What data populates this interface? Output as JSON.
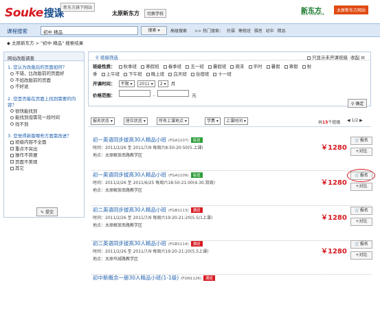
{
  "header": {
    "logo_main": "Souke",
    "logo_ke": "搜课",
    "sub_tag": "新东方旗下网站",
    "city": "太原新东方",
    "switch_school": "切换学校",
    "brand": "新东方",
    "brand_sub": "NEW ORIENTAL",
    "top_button": "太原新东方网站"
  },
  "search": {
    "label": "课程搜索",
    "query": "初中 精品",
    "search_button": "搜索",
    "advanced": "高级搜索",
    "hot_label": ">> 热门搜索：",
    "hot_items": [
      "托福",
      "寒假班",
      "雅思",
      "初中",
      "精品"
    ]
  },
  "breadcrumb": "太原新东方 > \"初中 精品\" 搜索结果",
  "survey": {
    "title": "网站改版调查",
    "q1": "1. 您认为改版后的页面如何？",
    "q1_opts": [
      "不错，比改版前的页面好",
      "不如改版前的页面",
      "不好说"
    ],
    "q2": "2. 您是否能在页面上找到需要的内容？",
    "q2_opts": [
      "很快能找到",
      "能找到但需花一段时间",
      "找不到"
    ],
    "q3": "3. 您觉得新版哪些方面需改进？",
    "q3_opts": [
      "班级内容不全面",
      "重点不突出",
      "操作不简便",
      "页面不美观",
      "其它"
    ],
    "submit": "提交"
  },
  "filter": {
    "title": "班级筛选",
    "only_open": "只显示未开课班级",
    "collapse": "收起",
    "type_label": "班级性质：",
    "types_row1": [
      "秋季班",
      "寒假班",
      "春季班",
      "五一班",
      "暑假班",
      "周末",
      "平时",
      "暑假",
      "寒假",
      "秋"
    ],
    "types_row2": [
      "季",
      "上午班",
      "下午班",
      "晚上班",
      "白天班",
      "住宿班",
      "十一班"
    ],
    "time_label": "开课时间：",
    "time_limit": "不限",
    "time_year": "2011",
    "time_month": "2",
    "time_unit": "月",
    "price_label": "价格范围：",
    "price_sep": "-",
    "price_unit": "元",
    "confirm": "确定"
  },
  "sortbar": {
    "status": "报名状态",
    "seats": "座位状态",
    "location": "所有上课地点",
    "tuition": "学费",
    "start": "上课时间",
    "total_pre": "共",
    "total_num": "15",
    "total_post": "个班级",
    "pager": "1/2"
  },
  "courses": [
    {
      "title": "初一英语同步拔高30人精品小班",
      "code": "(FGA1107)",
      "tag": "有班",
      "tag_color": "#2e9e3a",
      "time": "时间：2011/2/26 至 2011/7/9  每周六8:50-20:50(5.上课)",
      "place": "地点：太原解放南路教学区",
      "price": "￥1280",
      "signup": "报名",
      "compare": "对比"
    },
    {
      "title": "初一英语同步拔高30人精品小班",
      "code": "(FGA1109)",
      "tag": "有班",
      "tag_color": "#2e9e3a",
      "time": "时间：2011/2/26 至 2011/6/25  每周六18:50-21:00(4.30.双周)",
      "place": "地点：太原解放南路教学区",
      "price": "￥1280",
      "signup": "报名",
      "compare": "对比"
    },
    {
      "title": "初二英语同步拔高30人精品小班",
      "code": "(FGB1113)",
      "tag": "满班",
      "tag_color": "#d71920",
      "time": "时间：2011/2/26 至 2011/7/9  每周六19:20-21:20(5.5/1上课)",
      "place": "地点：太原解放南路教学区",
      "price": "￥1280",
      "signup": "报名",
      "compare": "对比"
    },
    {
      "title": "初二英语同步拔高30人精品小班",
      "code": "(FGB1114)",
      "tag": "满班",
      "tag_color": "#d71920",
      "time": "时间：2011/2/26 至 2011/7/9  每周六19:20-21:20(5.5上课)",
      "place": "地点：太原坞城路教学区",
      "price": "￥1280",
      "signup": "报名",
      "compare": "对比"
    },
    {
      "title": "初中新概念一册30人精品小班(1-1级)",
      "code": "(FGN1126)",
      "tag": "满班",
      "tag_color": "#d71920",
      "time": "",
      "place": "",
      "price": "",
      "signup": "",
      "compare": ""
    }
  ]
}
